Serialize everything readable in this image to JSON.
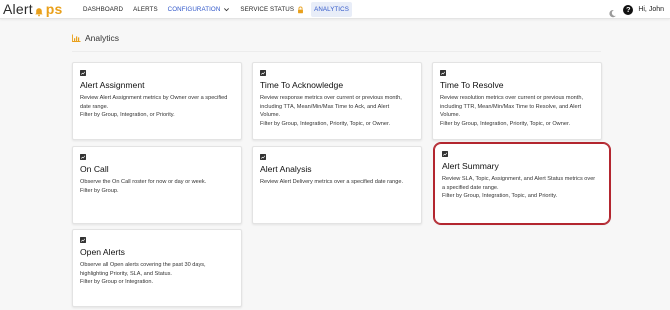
{
  "brand": {
    "part1": "Alert",
    "part2": "ps"
  },
  "nav": {
    "dashboard": "DASHBOARD",
    "alerts": "ALERTS",
    "configuration": "CONFIGURATION",
    "service_status": "SERVICE STATUS",
    "analytics": "ANALYTICS"
  },
  "user": {
    "greeting": "Hi, John"
  },
  "section": {
    "title": "Analytics"
  },
  "cards": [
    {
      "title": "Alert Assignment",
      "lines": [
        "Review Alert Assignment metrics by Owner over a specified",
        "date range.",
        "Filter by Group, Integration, or Priority."
      ]
    },
    {
      "title": "Time To Acknowledge",
      "lines": [
        "Review response metrics over current or previous month,",
        "including TTA, Mean/Min/Max Time to Ack, and Alert",
        "Volume.",
        "Filter by Group, Integration, Priority, Topic, or Owner."
      ]
    },
    {
      "title": "Time To Resolve",
      "lines": [
        "Review resolution metrics over current or previous month,",
        "including TTR, Mean/Min/Max Time to Resolve, and Alert",
        "Volume.",
        "Filter by Group, Integration, Priority, Topic, or Owner."
      ]
    },
    {
      "title": "On Call",
      "lines": [
        "Observe the On Call roster for now or day or week.",
        "Filter by Group."
      ]
    },
    {
      "title": "Alert Analysis",
      "lines": [
        "Review Alert Delivery metrics over a specified date range."
      ]
    },
    {
      "title": "Alert Summary",
      "lines": [
        "Review SLA, Topic, Assignment, and Alert Status metrics over",
        "a specified date range.",
        "Filter by Group, Integration, Topic, and Priority."
      ]
    },
    {
      "title": "Open Alerts",
      "lines": [
        "Observe all Open alerts covering the past 30 days,",
        "highlighting Priority, SLA, and Status.",
        "Filter by Group or Integration."
      ]
    }
  ],
  "colors": {
    "accent": "#2f56c9",
    "brand_orange": "#e9a01b",
    "highlight": "#b3262f"
  },
  "icons": {
    "theme": "moon-icon",
    "help": "help-icon",
    "section": "bar-chart-icon",
    "card": "chart-icon",
    "lock": "lock-icon"
  }
}
